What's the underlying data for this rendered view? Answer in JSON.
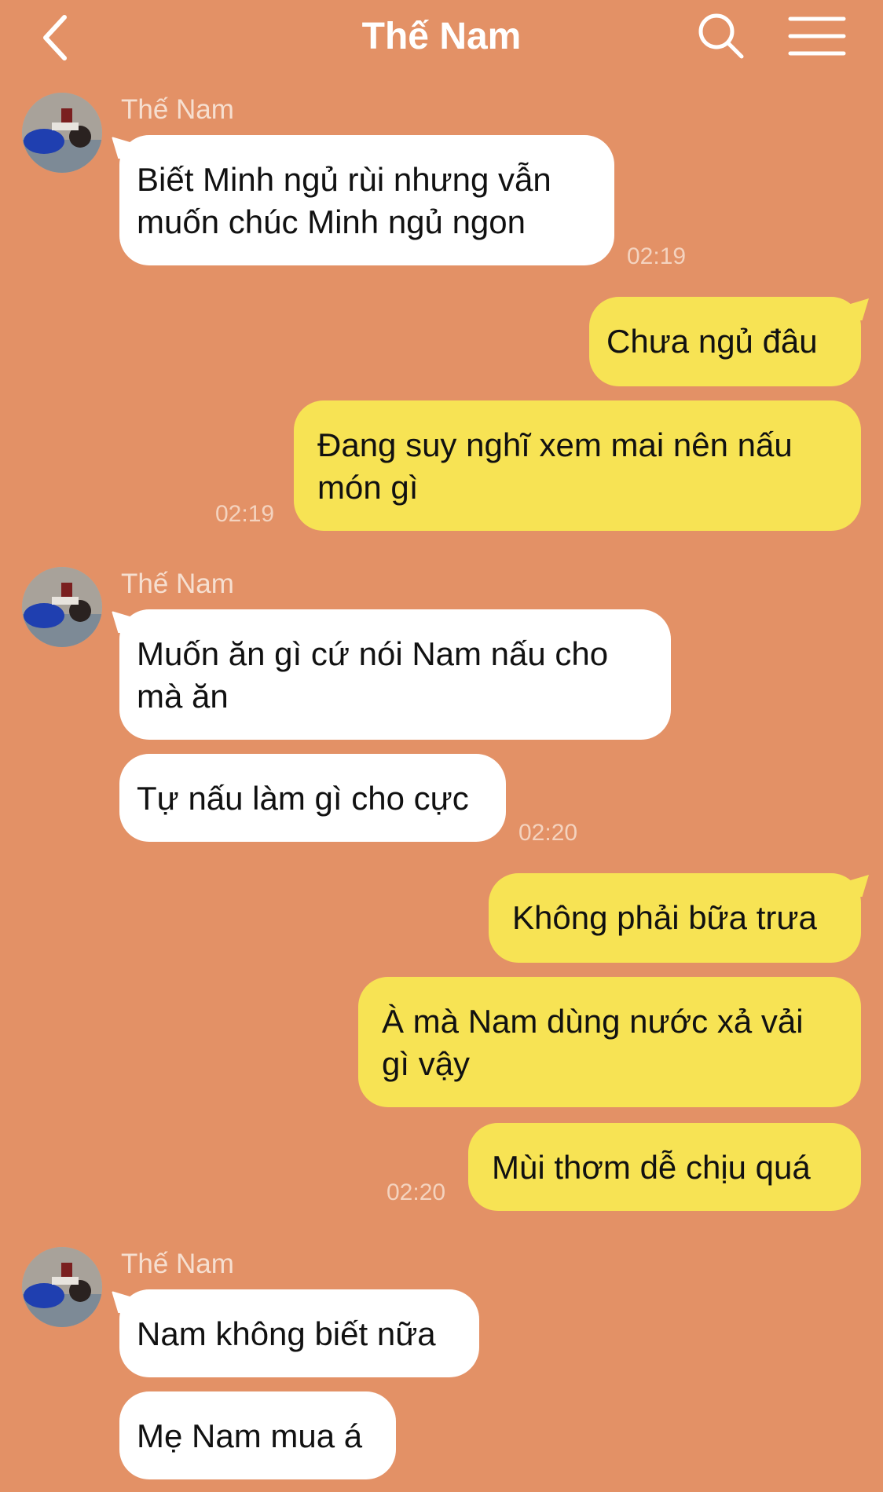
{
  "header": {
    "title": "Thế Nam",
    "back_icon": "chevron-left-icon",
    "search_icon": "search-icon",
    "menu_icon": "menu-icon"
  },
  "colors": {
    "background": "#E39166",
    "incoming_bubble": "#FFFFFF",
    "outgoing_bubble": "#F7E354"
  },
  "messages": [
    {
      "sender": "Thế Nam",
      "text": "Biết Minh ngủ rùi nhưng vẫn\nmuốn chúc Minh ngủ ngon",
      "time": "02:19"
    },
    {
      "text": "Chưa ngủ đâu"
    },
    {
      "text": "Đang suy nghĩ xem mai nên nấu\nmón gì",
      "time": "02:19"
    },
    {
      "sender": "Thế Nam",
      "text": "Muốn ăn gì cứ nói Nam nấu cho\nmà ăn"
    },
    {
      "text": "Tự nấu làm gì cho cực",
      "time": "02:20"
    },
    {
      "text": "Không phải bữa trưa"
    },
    {
      "text": "À mà Nam dùng nước xả vải\ngì vậy"
    },
    {
      "text": "Mùi thơm dễ chịu quá",
      "time": "02:20"
    },
    {
      "sender": "Thế Nam",
      "text": "Nam không biết nữa"
    },
    {
      "text": "Mẹ Nam mua á"
    }
  ]
}
